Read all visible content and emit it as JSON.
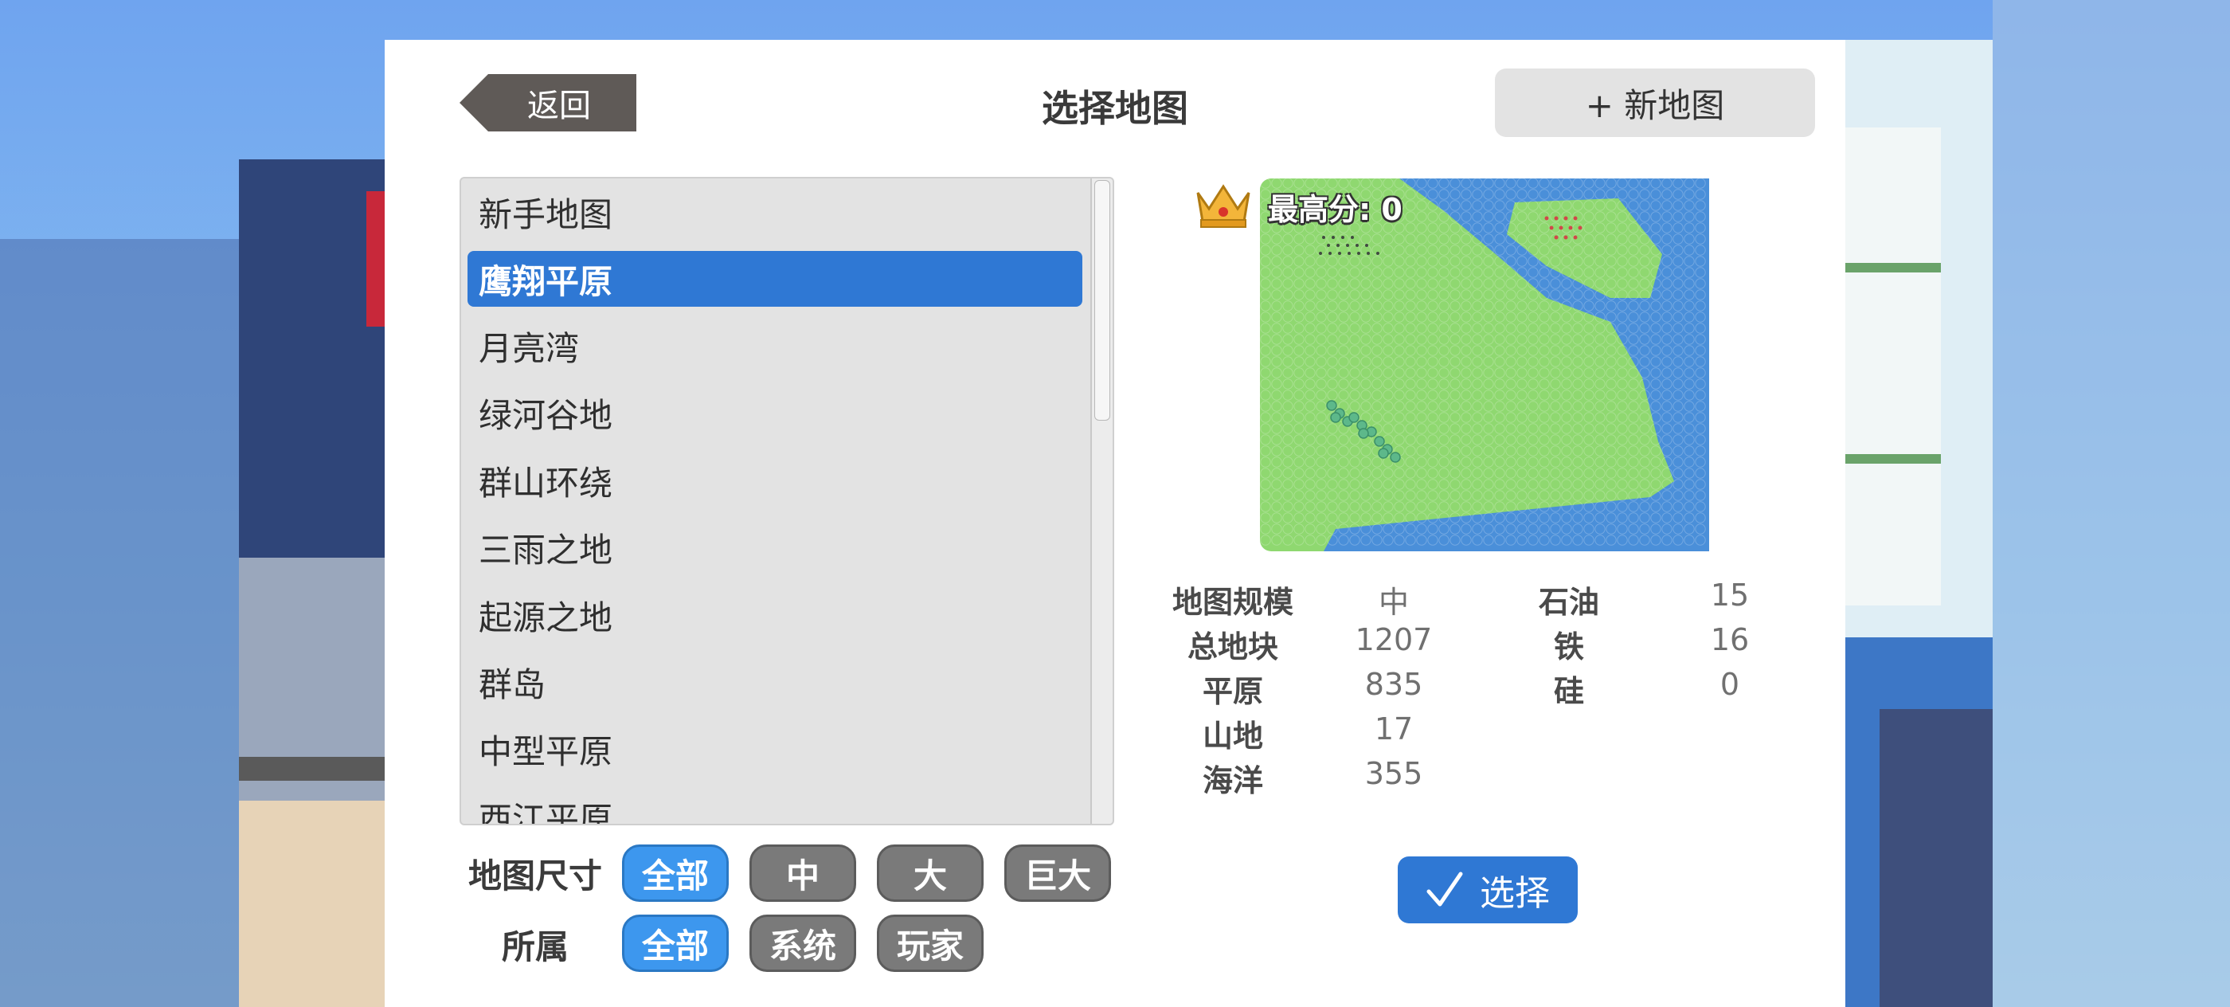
{
  "header": {
    "back_label": "返回",
    "title": "选择地图",
    "new_map_label": "+ 新地图"
  },
  "map_list": {
    "items": [
      {
        "label": "新手地图"
      },
      {
        "label": "鹰翔平原",
        "selected": true
      },
      {
        "label": "月亮湾"
      },
      {
        "label": "绿河谷地"
      },
      {
        "label": "群山环绕"
      },
      {
        "label": "三雨之地"
      },
      {
        "label": "起源之地"
      },
      {
        "label": "群岛"
      },
      {
        "label": "中型平原"
      },
      {
        "label": "西江平原"
      }
    ]
  },
  "filters": {
    "size_label": "地图尺寸",
    "size_options": [
      {
        "label": "全部",
        "active": true
      },
      {
        "label": "中",
        "active": false
      },
      {
        "label": "大",
        "active": false
      },
      {
        "label": "巨大",
        "active": false
      }
    ],
    "owner_label": "所属",
    "owner_options": [
      {
        "label": "全部",
        "active": true
      },
      {
        "label": "系统",
        "active": false
      },
      {
        "label": "玩家",
        "active": false
      }
    ]
  },
  "preview": {
    "high_score_label": "最高分: 0",
    "crown_icon": "crown-icon"
  },
  "stats": {
    "left": [
      {
        "label": "地图规模",
        "value": "中"
      },
      {
        "label": "总地块",
        "value": "1207"
      },
      {
        "label": "平原",
        "value": "835"
      },
      {
        "label": "山地",
        "value": "17"
      },
      {
        "label": "海洋",
        "value": "355"
      }
    ],
    "right": [
      {
        "label": "石油",
        "value": "15"
      },
      {
        "label": "铁",
        "value": "16"
      },
      {
        "label": "硅",
        "value": "0"
      }
    ]
  },
  "select_button": {
    "label": "选择",
    "icon": "checkmark-icon"
  },
  "colors": {
    "accent_blue": "#2f78d4",
    "pill_blue": "#3d97ee",
    "land_green": "#8fd870",
    "ocean_blue": "#4a8fd9"
  }
}
